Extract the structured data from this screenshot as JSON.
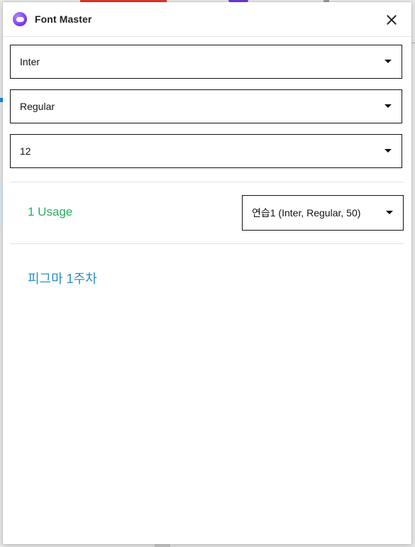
{
  "window": {
    "title": "Font Master",
    "app_icon": "font-master-app-icon",
    "close_icon": "close-icon"
  },
  "filters": {
    "font_family": "Inter",
    "font_style": "Regular",
    "font_size": "12"
  },
  "usage": {
    "count_label": "1 Usage",
    "selected_style": "연습1 (Inter, Regular, 50)"
  },
  "pages": [
    {
      "label": "피그마 1주차"
    }
  ],
  "colors": {
    "usage_text": "#27ae60",
    "page_link": "#2a8fc4",
    "app_icon": "#7b3ff2"
  }
}
